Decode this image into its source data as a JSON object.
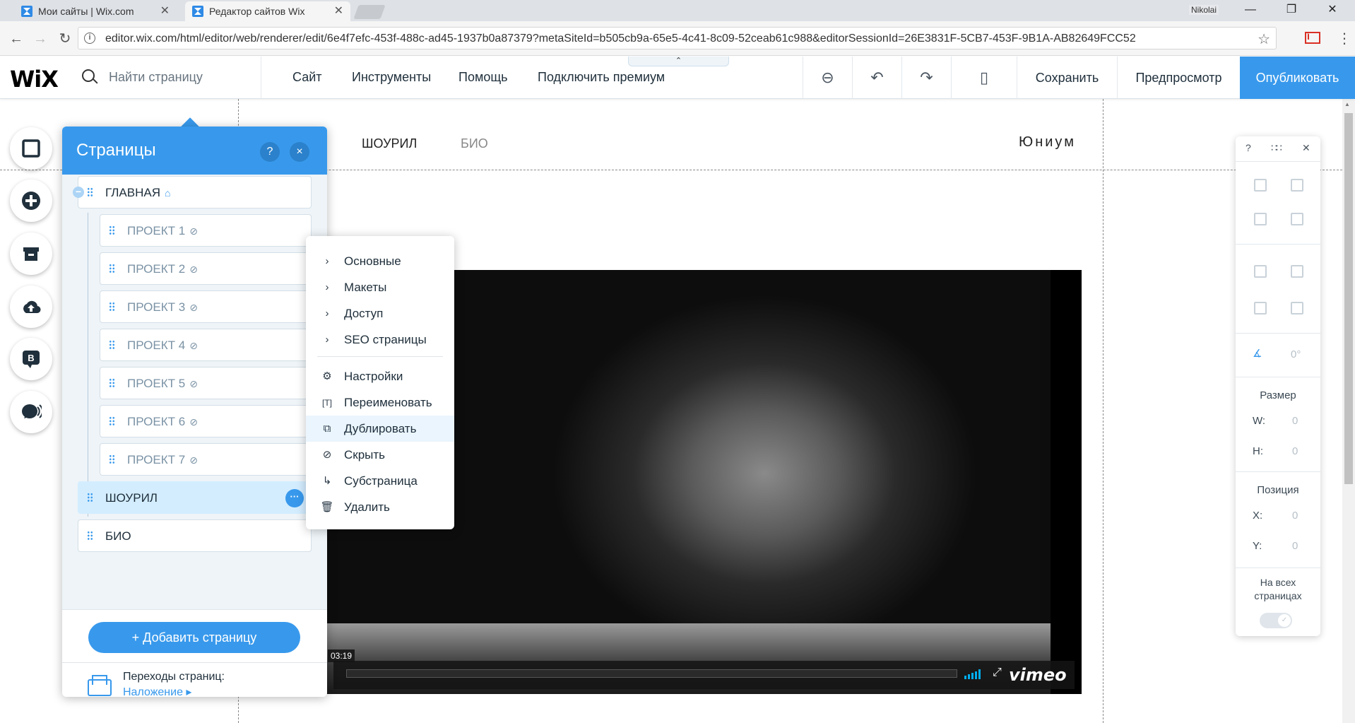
{
  "browser": {
    "tabs": [
      {
        "title": "Мои сайты | Wix.com",
        "active": false
      },
      {
        "title": "Редактор сайтов Wix",
        "active": true
      }
    ],
    "user": "Nikolai",
    "url": "editor.wix.com/html/editor/web/renderer/edit/6e4f7efc-453f-488c-ad45-1937b0a87379?metaSiteId=b505cb9a-65e5-4c41-8c09-52ceab61c988&editorSessionId=26E3831F-5CB7-453F-9B1A-AB82649FCC52"
  },
  "topbar": {
    "logo": "WiX",
    "search_placeholder": "Найти страницу",
    "menu": [
      "Сайт",
      "Инструменты",
      "Помощь",
      "Подключить премиум"
    ],
    "save": "Сохранить",
    "preview": "Предпросмотр",
    "publish": "Опубликовать"
  },
  "site": {
    "nav": [
      "ШОУРИЛ",
      "БИО"
    ],
    "title": "Юниум",
    "video": {
      "time": "03:19",
      "brand": "vimeo"
    }
  },
  "pages_panel": {
    "title": "Страницы",
    "help": "?",
    "close": "×",
    "pages": [
      {
        "label": "ГЛАВНАЯ",
        "home": true,
        "level": 0
      },
      {
        "label": "ПРОЕКТ 1",
        "hidden": true,
        "level": 1
      },
      {
        "label": "ПРОЕКТ 2",
        "hidden": true,
        "level": 1
      },
      {
        "label": "ПРОЕКТ 3",
        "hidden": true,
        "level": 1
      },
      {
        "label": "ПРОЕКТ 4",
        "hidden": true,
        "level": 1
      },
      {
        "label": "ПРОЕКТ 5",
        "hidden": true,
        "level": 1
      },
      {
        "label": "ПРОЕКТ 6",
        "hidden": true,
        "level": 1
      },
      {
        "label": "ПРОЕКТ 7",
        "hidden": true,
        "level": 1
      },
      {
        "label": "ШОУРИЛ",
        "selected": true,
        "level": 0
      },
      {
        "label": "БИО",
        "level": 0
      }
    ],
    "add_page": "+ Добавить страницу",
    "transitions_label": "Переходы страниц:",
    "transitions_value": "Наложение ▸"
  },
  "context_menu": {
    "submenus": [
      "Основные",
      "Макеты",
      "Доступ",
      "SEO страницы"
    ],
    "actions": [
      {
        "label": "Настройки",
        "icon": "settings-icon"
      },
      {
        "label": "Переименовать",
        "icon": "rename-icon"
      },
      {
        "label": "Дублировать",
        "icon": "duplicate-icon",
        "highlighted": true
      },
      {
        "label": "Скрыть",
        "icon": "hide-icon"
      },
      {
        "label": "Субстраница",
        "icon": "subpage-icon"
      },
      {
        "label": "Удалить",
        "icon": "trash-icon"
      }
    ]
  },
  "properties": {
    "help": "?",
    "rotation": "0°",
    "size_label": "Размер",
    "w_label": "W:",
    "w_value": "0",
    "h_label": "H:",
    "h_value": "0",
    "position_label": "Позиция",
    "x_label": "X:",
    "x_value": "0",
    "y_label": "Y:",
    "y_value": "0",
    "all_pages_label": "На всех страницах"
  },
  "colors": {
    "accent": "#3899ec",
    "selected_bg": "#d3edff",
    "panel_bg": "#eef4f8"
  }
}
